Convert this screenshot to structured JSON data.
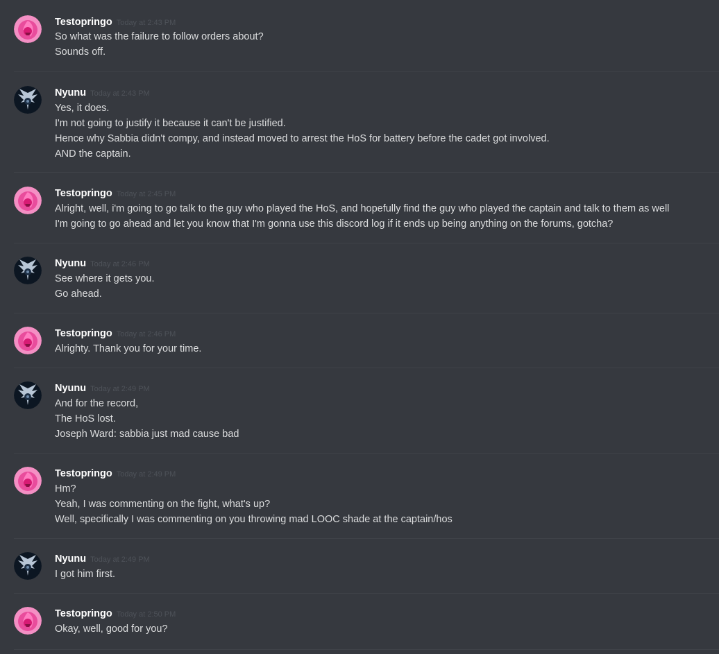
{
  "messages": [
    {
      "author": "Testopringo",
      "avatar": "pink-gem-avatar-icon",
      "timestamp": "Today at 2:43 PM",
      "lines": [
        "So what was the failure to follow orders about?",
        "Sounds off."
      ]
    },
    {
      "author": "Nyunu",
      "avatar": "dark-creature-avatar-icon",
      "timestamp": "Today at 2:43 PM",
      "lines": [
        "Yes, it does.",
        "I'm not going to justify it because it can't be justified.",
        "Hence why Sabbia didn't compy, and instead moved to arrest the HoS for battery before the cadet got involved.",
        "AND the captain."
      ]
    },
    {
      "author": "Testopringo",
      "avatar": "pink-gem-avatar-icon",
      "timestamp": "Today at 2:45 PM",
      "lines": [
        "Alright, well, i'm going to go talk to the guy who played the HoS, and hopefully find the guy who played the captain and talk to them as well",
        "I'm going to go ahead and let you know that I'm gonna use this discord log if it ends up being anything on the forums, gotcha?"
      ]
    },
    {
      "author": "Nyunu",
      "avatar": "dark-creature-avatar-icon",
      "timestamp": "Today at 2:46 PM",
      "lines": [
        "See where it gets you.",
        "Go ahead."
      ]
    },
    {
      "author": "Testopringo",
      "avatar": "pink-gem-avatar-icon",
      "timestamp": "Today at 2:46 PM",
      "lines": [
        "Alrighty. Thank you for your time."
      ]
    },
    {
      "author": "Nyunu",
      "avatar": "dark-creature-avatar-icon",
      "timestamp": "Today at 2:49 PM",
      "lines": [
        "And for the record,",
        "The HoS lost.",
        "Joseph Ward: sabbia just mad cause bad"
      ]
    },
    {
      "author": "Testopringo",
      "avatar": "pink-gem-avatar-icon",
      "timestamp": "Today at 2:49 PM",
      "lines": [
        "Hm?",
        "Yeah, I was commenting on the fight, what's up?",
        "Well, specifically I was commenting on you throwing mad LOOC shade at the captain/hos"
      ]
    },
    {
      "author": "Nyunu",
      "avatar": "dark-creature-avatar-icon",
      "timestamp": "Today at 2:49 PM",
      "lines": [
        "I got him first."
      ]
    },
    {
      "author": "Testopringo",
      "avatar": "pink-gem-avatar-icon",
      "timestamp": "Today at 2:50 PM",
      "lines": [
        "Okay, well, good for you?"
      ]
    }
  ],
  "colors": {
    "background": "#36393f",
    "username": "#ffffff",
    "timestamp": "#4e5259",
    "text": "#dcddde",
    "divider": "#3f4248"
  }
}
